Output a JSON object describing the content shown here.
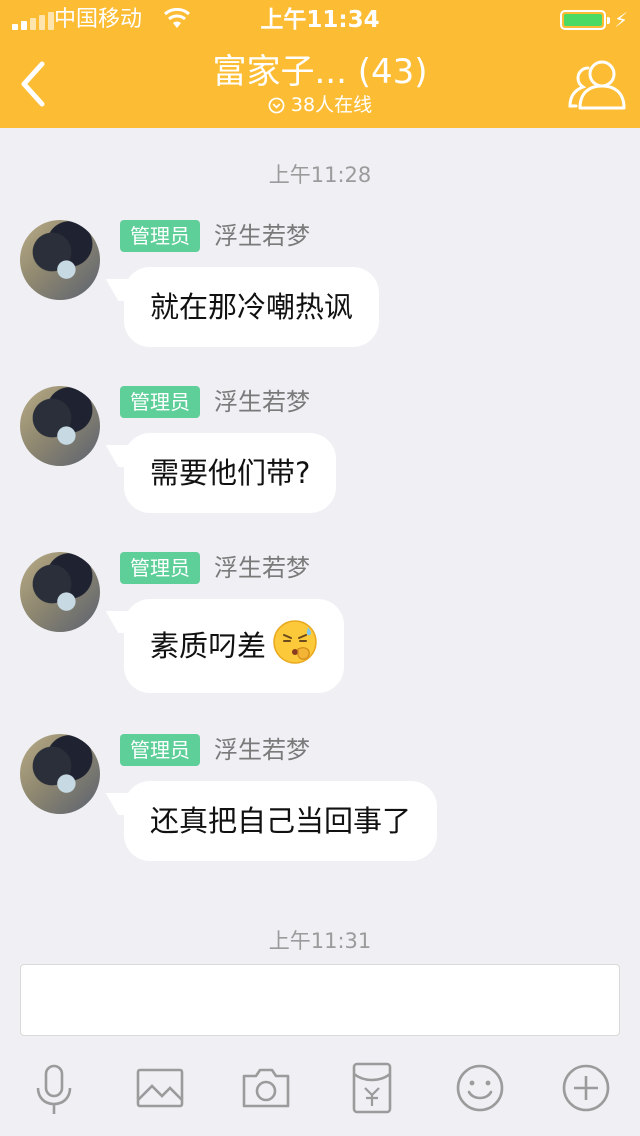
{
  "status_bar": {
    "carrier": "中国移动",
    "time": "上午11:34",
    "charge_symbol": "⚡"
  },
  "nav": {
    "title": "富家子... (43)",
    "online": "38人在线"
  },
  "timestamps": [
    "上午11:28",
    "上午11:31"
  ],
  "messages": [
    {
      "role": "管理员",
      "sender": "浮生若梦",
      "text": "就在那冷嘲热讽"
    },
    {
      "role": "管理员",
      "sender": "浮生若梦",
      "text": "需要他们带?"
    },
    {
      "role": "管理员",
      "sender": "浮生若梦",
      "text": "素质叼差",
      "emoji": "sweating-face-emoji"
    },
    {
      "role": "管理员",
      "sender": "浮生若梦",
      "text": "还真把自己当回事了"
    }
  ],
  "input": {
    "value": ""
  },
  "toolbar": [
    "microphone-icon",
    "image-icon",
    "camera-icon",
    "red-packet-icon",
    "smiley-icon",
    "plus-icon"
  ],
  "colors": {
    "header": "#fcbd35",
    "admin_badge": "#5fcf9a",
    "battery": "#4cd964",
    "background": "#efeff4",
    "toolbar_icons": "#9b9b9b"
  }
}
